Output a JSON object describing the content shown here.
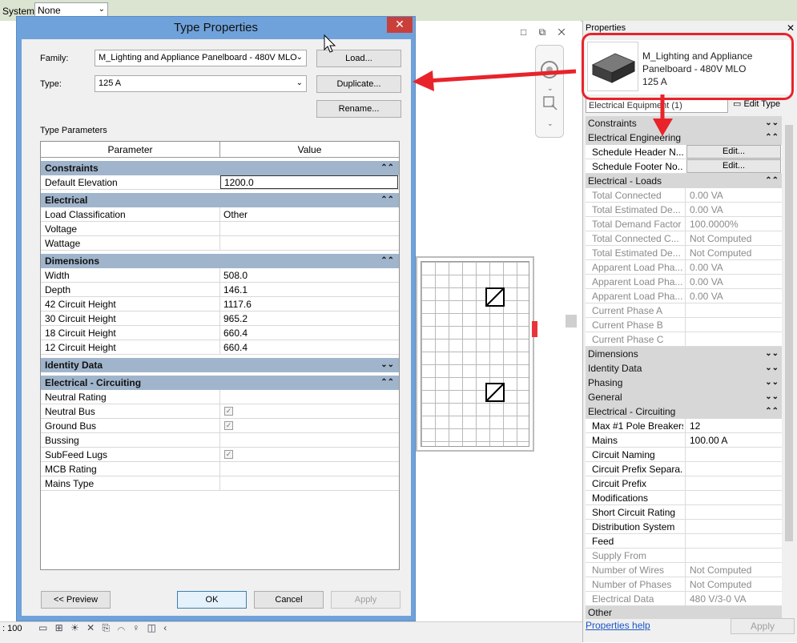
{
  "system_bar": {
    "label": "System:",
    "value": "None"
  },
  "view_controls": "□ ⧉ ✕",
  "type_properties": {
    "title": "Type Properties",
    "family_label": "Family:",
    "family_value": "M_Lighting and Appliance Panelboard - 480V MLO",
    "type_label": "Type:",
    "type_value": "125 A",
    "load_label": "Load...",
    "duplicate_label": "Duplicate...",
    "rename_label": "Rename...",
    "section_label": "Type Parameters",
    "col_parameter": "Parameter",
    "col_value": "Value",
    "groups": {
      "constraints": "Constraints",
      "electrical": "Electrical",
      "dimensions": "Dimensions",
      "identity": "Identity Data",
      "circuiting": "Electrical - Circuiting"
    },
    "params": {
      "default_elevation": {
        "name": "Default Elevation",
        "value": "1200.0"
      },
      "load_classification": {
        "name": "Load Classification",
        "value": "Other"
      },
      "voltage": {
        "name": "Voltage",
        "value": ""
      },
      "wattage": {
        "name": "Wattage",
        "value": ""
      },
      "width": {
        "name": "Width",
        "value": "508.0"
      },
      "depth": {
        "name": "Depth",
        "value": "146.1"
      },
      "h42": {
        "name": "42 Circuit Height",
        "value": "1117.6"
      },
      "h30": {
        "name": "30 Circuit Height",
        "value": "965.2"
      },
      "h18": {
        "name": "18 Circuit Height",
        "value": "660.4"
      },
      "h12": {
        "name": "12 Circuit Height",
        "value": "660.4"
      },
      "neutral_rating": {
        "name": "Neutral Rating",
        "value": ""
      },
      "neutral_bus": {
        "name": "Neutral Bus",
        "checked": true
      },
      "ground_bus": {
        "name": "Ground Bus",
        "checked": true
      },
      "bussing": {
        "name": "Bussing",
        "value": ""
      },
      "subfeed_lugs": {
        "name": "SubFeed Lugs",
        "checked": true
      },
      "mcb_rating": {
        "name": "MCB Rating",
        "value": ""
      },
      "mains_type": {
        "name": "Mains Type",
        "value": ""
      }
    },
    "preview_label": "<< Preview",
    "ok_label": "OK",
    "cancel_label": "Cancel",
    "apply_label": "Apply"
  },
  "properties_panel": {
    "title": "Properties",
    "type_name": "M_Lighting and Appliance Panelboard - 480V MLO 125 A",
    "type_line1": "M_Lighting and Appliance",
    "type_line2": "Panelboard - 480V MLO",
    "type_line3": "125 A",
    "filter": "Electrical Equipment (1)",
    "edit_type": "Edit Type",
    "rows": {
      "constraints": "Constraints",
      "elec_eng": "Electrical Engineering",
      "schedule_header": {
        "name": "Schedule Header N...",
        "value": "Edit..."
      },
      "schedule_footer": {
        "name": "Schedule Footer No...",
        "value": "Edit..."
      },
      "elec_loads": "Electrical - Loads",
      "total_connected": {
        "name": "Total Connected",
        "value": "0.00 VA"
      },
      "total_est_de": {
        "name": "Total Estimated De...",
        "value": "0.00 VA"
      },
      "total_demand_factor": {
        "name": "Total Demand Factor",
        "value": "100.0000%"
      },
      "total_connected_c": {
        "name": "Total Connected C...",
        "value": "Not Computed"
      },
      "total_est_de2": {
        "name": "Total Estimated De...",
        "value": "Not Computed"
      },
      "apparent_a": {
        "name": "Apparent Load Pha...",
        "value": "0.00 VA"
      },
      "apparent_b": {
        "name": "Apparent Load Pha...",
        "value": "0.00 VA"
      },
      "apparent_c": {
        "name": "Apparent Load Pha...",
        "value": "0.00 VA"
      },
      "current_a": {
        "name": "Current Phase A",
        "value": ""
      },
      "current_b": {
        "name": "Current Phase B",
        "value": ""
      },
      "current_c": {
        "name": "Current Phase C",
        "value": ""
      },
      "dimensions": "Dimensions",
      "identity": "Identity Data",
      "phasing": "Phasing",
      "general": "General",
      "circuiting": "Electrical - Circuiting",
      "max_pole": {
        "name": "Max #1 Pole Breakers",
        "value": "12"
      },
      "mains": {
        "name": "Mains",
        "value": "100.00 A"
      },
      "circuit_naming": {
        "name": "Circuit Naming",
        "value": ""
      },
      "circuit_prefix_sep": {
        "name": "Circuit Prefix Separa...",
        "value": ""
      },
      "circuit_prefix": {
        "name": "Circuit Prefix",
        "value": ""
      },
      "modifications": {
        "name": "Modifications",
        "value": ""
      },
      "short_circuit": {
        "name": "Short Circuit Rating",
        "value": ""
      },
      "distribution": {
        "name": "Distribution System",
        "value": ""
      },
      "feed": {
        "name": "Feed",
        "value": ""
      },
      "supply_from": {
        "name": "Supply From",
        "value": ""
      },
      "num_wires": {
        "name": "Number of Wires",
        "value": "Not Computed"
      },
      "num_phases": {
        "name": "Number of Phases",
        "value": "Not Computed"
      },
      "electrical_data": {
        "name": "Electrical Data",
        "value": "480 V/3-0 VA"
      },
      "other": "Other"
    },
    "help_link": "Properties help",
    "apply_label": "Apply"
  },
  "status_bar": {
    "scale": ": 100",
    "icons": "▭ ⊞ ☀ ✕ ⎘ ⌒ ♀ ◫ ‹"
  },
  "colors": {
    "dialog_frame": "#6fa2da",
    "group_header": "#a0b5cc",
    "close_red": "#c9403a",
    "annotation_red": "#e8232a",
    "link_blue": "#1a55c7"
  }
}
